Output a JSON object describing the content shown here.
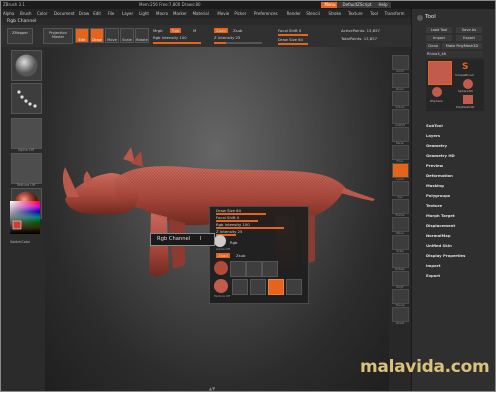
{
  "titlebar": {
    "app": "ZBrush 3.1 ",
    "stats": "Mem:256 Free:7,800 Draws:80",
    "menu_btn": "Menu",
    "script_btn": "DefaultZScript",
    "help_btn": "Help"
  },
  "menus": [
    "Alpha",
    "Brush",
    "Color",
    "Document",
    "Draw",
    "Edit",
    "File",
    "Layer",
    "Light",
    "Macro",
    "Marker",
    "Material",
    "Movie",
    "Picker",
    "Preferences",
    "Render",
    "Stencil",
    "Stroke",
    "Texture",
    "Tool",
    "Transform",
    "Zoom",
    "Zplugin",
    "Zscript"
  ],
  "left_title": "Rgb Channel",
  "toolbar": {
    "zmapper_label": "ZMapper",
    "projection_label": "Projection Master",
    "lightbox_label": "LightBox",
    "buttons": [
      "Edit",
      "Draw",
      "Move",
      "Scale",
      "Rotate"
    ],
    "rgb_label": "Rgb",
    "m_label": "M",
    "mrgb_label": "Mrgb",
    "rgb_intensity": "Rgb Intensity 100",
    "zadd_label": "Zadd",
    "zsub_label": "Zsub",
    "z_intensity": "Z Intensity 25",
    "focal_shift": "Focal Shift 0",
    "draw_size": "Draw Size 64",
    "active_points": "ActivePoints: 13,857",
    "total_points": "TotalPoints: 13,857"
  },
  "left_panel": {
    "alpha_label": "Alpha Off",
    "texture_label": "Texture Off",
    "switch_color": "SwitchColor"
  },
  "dock": [
    "Scroll",
    "Zoom",
    "Actual",
    "AAHalf",
    "Persp",
    "Floor",
    "Local",
    "Xyz",
    "Frame",
    "Move",
    "Scale",
    "Rotate",
    "PolyF",
    "Transp",
    "Ghost"
  ],
  "tool_panel": {
    "title": "Tool",
    "load_btn": "Load Tool",
    "save_btn": "Save As",
    "import_btn": "Import",
    "export_btn": "Export",
    "clone_btn": "Clone",
    "make_btn": "Make PolyMesh3D",
    "current": "Rhino3_48",
    "tool_names": [
      "Rhino",
      "SimpleBrush",
      "Sphere3D",
      "ZSphere",
      "PolyMesh3D"
    ],
    "items": [
      "SubTool",
      "Layers",
      "Geometry",
      "Geometry HD",
      "Preview",
      "Deformation",
      "Masking",
      "Polygroups",
      "Texture",
      "Morph Target",
      "Displacement",
      "NormalMap",
      "Unified Skin",
      "Display Properties",
      "Import",
      "Export"
    ]
  },
  "popup": {
    "draw_size": "Draw Size 64",
    "focal_shift": "Focal Shift 0",
    "rgb_intensity": "Rgb Intensity 100",
    "z_intensity": "Z Intensity 25",
    "rgb_label": "Rgb",
    "zadd_label": "Zadd",
    "zsub_label": "Zsub",
    "alpha_off": "Alpha Off",
    "texture_off": "Texture Off"
  },
  "tooltip": "Rgb Channel",
  "tooltip_key": "I",
  "watermark": "malavida.com",
  "colors": {
    "accent": "#e5631a",
    "rhino": "#b85448",
    "background": "#2a2a2a"
  }
}
